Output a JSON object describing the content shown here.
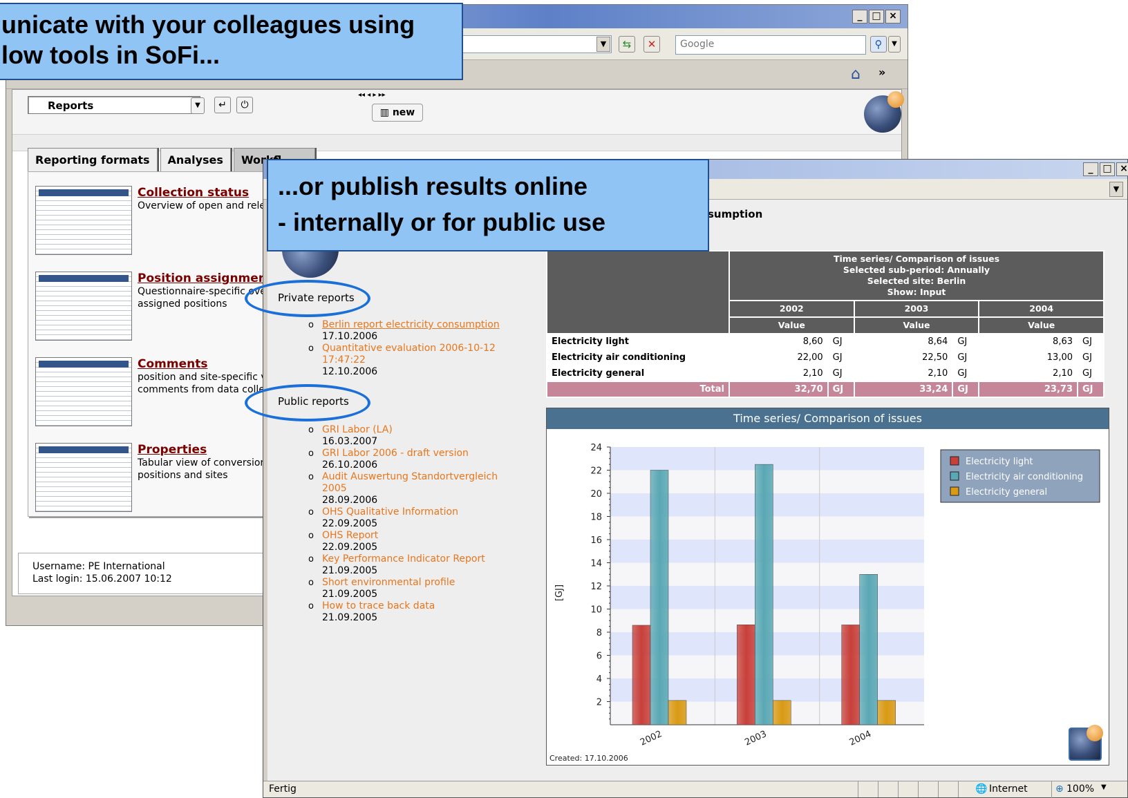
{
  "callout_top": {
    "line1": "unicate with your colleagues using",
    "line2": "low tools in SoFi..."
  },
  "callout_mid": {
    "line1": "...or publish results online",
    "line2": "- internally or for public use"
  },
  "browser_back": {
    "search_placeholder": "Google",
    "module_select": "Reports",
    "new_button": "new",
    "tabs": [
      "Reporting formats",
      "Analyses",
      "Workfl"
    ],
    "entries": [
      {
        "title": "Collection status",
        "desc": "Overview of open and relea"
      },
      {
        "title": "Position assignment",
        "desc": "Questionnaire-specific ove\nassigned positions"
      },
      {
        "title": "Comments",
        "desc": "position and site-specific v\ncomments from data colle"
      },
      {
        "title": "Properties",
        "desc": "Tabular view of conversion\npositions and sites"
      }
    ],
    "username": "Username: PE International",
    "last_login": "Last login: 15.06.2007 10:12"
  },
  "browser_front": {
    "report_title_partial": "sumption",
    "private_label": "Private reports",
    "public_label": "Public reports",
    "private_reports": [
      {
        "name": "Berlin report electricity consumption",
        "date": "17.10.2006"
      },
      {
        "name": "Quantitative evaluation 2006-10-12 17:47:22",
        "date": "12.10.2006"
      }
    ],
    "public_reports": [
      {
        "name": "GRI Labor (LA)",
        "date": "16.03.2007"
      },
      {
        "name": "GRI Labor 2006 - draft version",
        "date": "26.10.2006"
      },
      {
        "name": "Audit Auswertung Standortvergleich 2005",
        "date": "28.09.2006"
      },
      {
        "name": "OHS Qualitative Information",
        "date": "22.09.2005"
      },
      {
        "name": "OHS Report",
        "date": "22.09.2005"
      },
      {
        "name": "Key Performance Indicator Report",
        "date": "21.09.2005"
      },
      {
        "name": "Short environmental profile",
        "date": "21.09.2005"
      },
      {
        "name": "How to trace back data",
        "date": "21.09.2005"
      }
    ],
    "status_left": "Fertig",
    "status_zone": "Internet",
    "status_zoom": "100%"
  },
  "report_table": {
    "header_lines": [
      "Time series/ Comparison of issues",
      "Selected sub-period: Annually",
      "Selected site: Berlin",
      "Show: Input"
    ],
    "years": [
      "2002",
      "2003",
      "2004"
    ],
    "value_label": "Value",
    "unit": "GJ",
    "rows": [
      {
        "label": "Electricity light",
        "values": [
          "8,60",
          "8,64",
          "8,63"
        ]
      },
      {
        "label": "Electricity air conditioning",
        "values": [
          "22,00",
          "22,50",
          "13,00"
        ]
      },
      {
        "label": "Electricity general",
        "values": [
          "2,10",
          "2,10",
          "2,10"
        ]
      }
    ],
    "total_label": "Total",
    "totals": [
      "32,70",
      "33,24",
      "23,73"
    ]
  },
  "chart_data": {
    "type": "bar",
    "title": "Time series/ Comparison of issues",
    "ylabel": "[GJ]",
    "categories": [
      "2002",
      "2003",
      "2004"
    ],
    "ylim": [
      0,
      24
    ],
    "yticks": [
      2,
      4,
      6,
      8,
      10,
      12,
      14,
      16,
      18,
      20,
      22,
      24
    ],
    "series": [
      {
        "name": "Electricity light",
        "values": [
          8.6,
          8.64,
          8.63
        ],
        "color": "#c8403a"
      },
      {
        "name": "Electricity air conditioning",
        "values": [
          22.0,
          22.5,
          13.0
        ],
        "color": "#5aa8b4"
      },
      {
        "name": "Electricity general",
        "values": [
          2.1,
          2.1,
          2.1
        ],
        "color": "#d99a14"
      }
    ],
    "legend_position": "top-right",
    "footnote": "Created: 17.10.2006"
  }
}
